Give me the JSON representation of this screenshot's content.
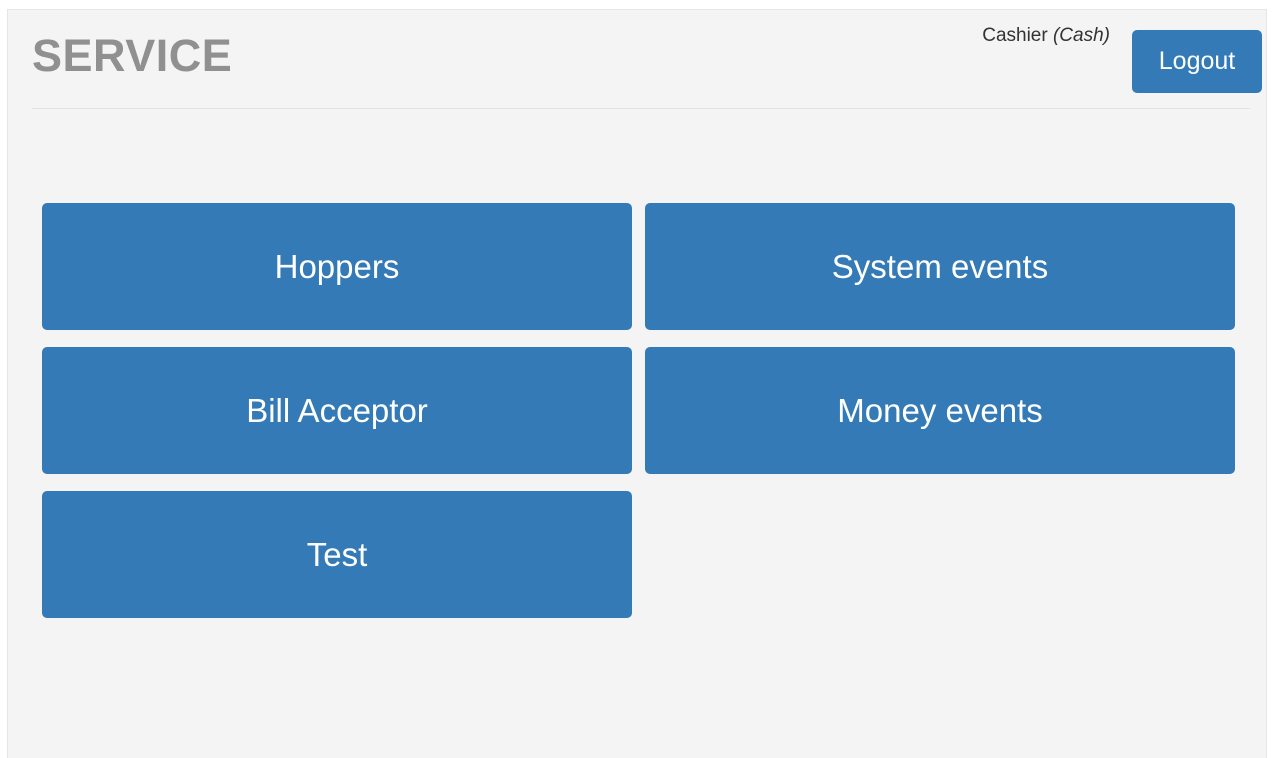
{
  "header": {
    "title": "SERVICE",
    "user_name": "Cashier",
    "user_role": "(Cash)",
    "logout_label": "Logout"
  },
  "menu": {
    "items": [
      {
        "label": "Hoppers"
      },
      {
        "label": "System events"
      },
      {
        "label": "Bill Acceptor"
      },
      {
        "label": "Money events"
      },
      {
        "label": "Test"
      }
    ]
  },
  "colors": {
    "accent": "#337ab7",
    "background": "#f4f4f4",
    "title_gray": "#909090"
  }
}
